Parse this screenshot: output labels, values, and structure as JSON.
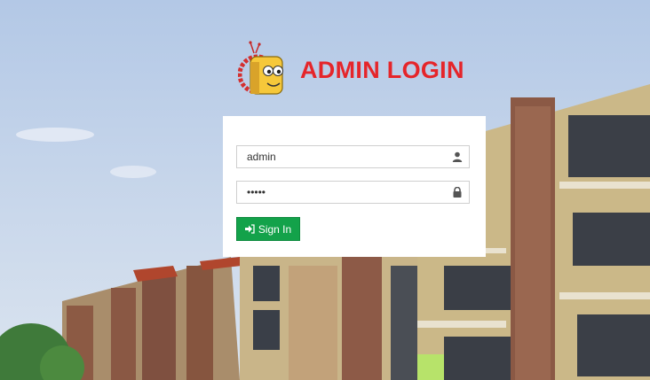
{
  "header": {
    "title": "ADMIN LOGIN",
    "logo_icon": "robot-mascot-logo"
  },
  "login": {
    "username_value": "admin",
    "username_icon": "user-icon",
    "password_value": "admin",
    "password_icon": "lock-icon",
    "submit_label": "Sign In",
    "submit_icon": "sign-in-icon",
    "submit_color": "#13a24a"
  },
  "colors": {
    "title": "#e5252a",
    "panel": "#ffffff"
  }
}
